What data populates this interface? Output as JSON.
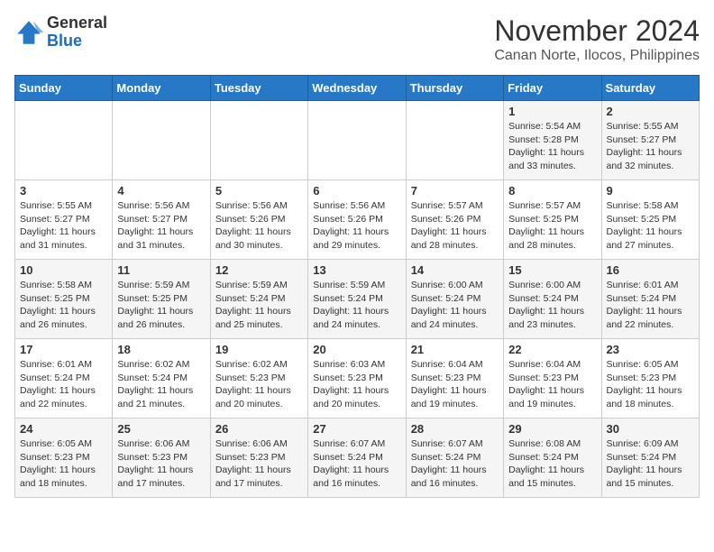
{
  "header": {
    "logo_general": "General",
    "logo_blue": "Blue",
    "month_title": "November 2024",
    "location": "Canan Norte, Ilocos, Philippines"
  },
  "days_of_week": [
    "Sunday",
    "Monday",
    "Tuesday",
    "Wednesday",
    "Thursday",
    "Friday",
    "Saturday"
  ],
  "weeks": [
    [
      {
        "day": "",
        "info": ""
      },
      {
        "day": "",
        "info": ""
      },
      {
        "day": "",
        "info": ""
      },
      {
        "day": "",
        "info": ""
      },
      {
        "day": "",
        "info": ""
      },
      {
        "day": "1",
        "info": "Sunrise: 5:54 AM\nSunset: 5:28 PM\nDaylight: 11 hours and 33 minutes."
      },
      {
        "day": "2",
        "info": "Sunrise: 5:55 AM\nSunset: 5:27 PM\nDaylight: 11 hours and 32 minutes."
      }
    ],
    [
      {
        "day": "3",
        "info": "Sunrise: 5:55 AM\nSunset: 5:27 PM\nDaylight: 11 hours and 31 minutes."
      },
      {
        "day": "4",
        "info": "Sunrise: 5:56 AM\nSunset: 5:27 PM\nDaylight: 11 hours and 31 minutes."
      },
      {
        "day": "5",
        "info": "Sunrise: 5:56 AM\nSunset: 5:26 PM\nDaylight: 11 hours and 30 minutes."
      },
      {
        "day": "6",
        "info": "Sunrise: 5:56 AM\nSunset: 5:26 PM\nDaylight: 11 hours and 29 minutes."
      },
      {
        "day": "7",
        "info": "Sunrise: 5:57 AM\nSunset: 5:26 PM\nDaylight: 11 hours and 28 minutes."
      },
      {
        "day": "8",
        "info": "Sunrise: 5:57 AM\nSunset: 5:25 PM\nDaylight: 11 hours and 28 minutes."
      },
      {
        "day": "9",
        "info": "Sunrise: 5:58 AM\nSunset: 5:25 PM\nDaylight: 11 hours and 27 minutes."
      }
    ],
    [
      {
        "day": "10",
        "info": "Sunrise: 5:58 AM\nSunset: 5:25 PM\nDaylight: 11 hours and 26 minutes."
      },
      {
        "day": "11",
        "info": "Sunrise: 5:59 AM\nSunset: 5:25 PM\nDaylight: 11 hours and 26 minutes."
      },
      {
        "day": "12",
        "info": "Sunrise: 5:59 AM\nSunset: 5:24 PM\nDaylight: 11 hours and 25 minutes."
      },
      {
        "day": "13",
        "info": "Sunrise: 5:59 AM\nSunset: 5:24 PM\nDaylight: 11 hours and 24 minutes."
      },
      {
        "day": "14",
        "info": "Sunrise: 6:00 AM\nSunset: 5:24 PM\nDaylight: 11 hours and 24 minutes."
      },
      {
        "day": "15",
        "info": "Sunrise: 6:00 AM\nSunset: 5:24 PM\nDaylight: 11 hours and 23 minutes."
      },
      {
        "day": "16",
        "info": "Sunrise: 6:01 AM\nSunset: 5:24 PM\nDaylight: 11 hours and 22 minutes."
      }
    ],
    [
      {
        "day": "17",
        "info": "Sunrise: 6:01 AM\nSunset: 5:24 PM\nDaylight: 11 hours and 22 minutes."
      },
      {
        "day": "18",
        "info": "Sunrise: 6:02 AM\nSunset: 5:24 PM\nDaylight: 11 hours and 21 minutes."
      },
      {
        "day": "19",
        "info": "Sunrise: 6:02 AM\nSunset: 5:23 PM\nDaylight: 11 hours and 20 minutes."
      },
      {
        "day": "20",
        "info": "Sunrise: 6:03 AM\nSunset: 5:23 PM\nDaylight: 11 hours and 20 minutes."
      },
      {
        "day": "21",
        "info": "Sunrise: 6:04 AM\nSunset: 5:23 PM\nDaylight: 11 hours and 19 minutes."
      },
      {
        "day": "22",
        "info": "Sunrise: 6:04 AM\nSunset: 5:23 PM\nDaylight: 11 hours and 19 minutes."
      },
      {
        "day": "23",
        "info": "Sunrise: 6:05 AM\nSunset: 5:23 PM\nDaylight: 11 hours and 18 minutes."
      }
    ],
    [
      {
        "day": "24",
        "info": "Sunrise: 6:05 AM\nSunset: 5:23 PM\nDaylight: 11 hours and 18 minutes."
      },
      {
        "day": "25",
        "info": "Sunrise: 6:06 AM\nSunset: 5:23 PM\nDaylight: 11 hours and 17 minutes."
      },
      {
        "day": "26",
        "info": "Sunrise: 6:06 AM\nSunset: 5:23 PM\nDaylight: 11 hours and 17 minutes."
      },
      {
        "day": "27",
        "info": "Sunrise: 6:07 AM\nSunset: 5:24 PM\nDaylight: 11 hours and 16 minutes."
      },
      {
        "day": "28",
        "info": "Sunrise: 6:07 AM\nSunset: 5:24 PM\nDaylight: 11 hours and 16 minutes."
      },
      {
        "day": "29",
        "info": "Sunrise: 6:08 AM\nSunset: 5:24 PM\nDaylight: 11 hours and 15 minutes."
      },
      {
        "day": "30",
        "info": "Sunrise: 6:09 AM\nSunset: 5:24 PM\nDaylight: 11 hours and 15 minutes."
      }
    ]
  ]
}
